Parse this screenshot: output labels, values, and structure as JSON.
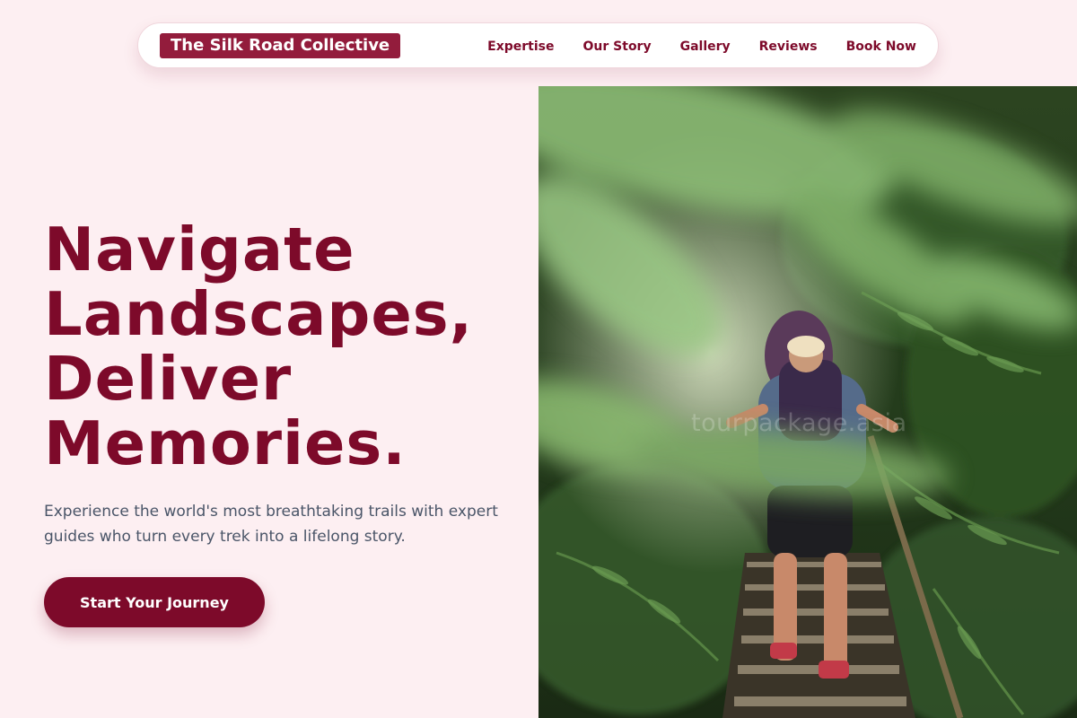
{
  "brand": {
    "name": "The Silk Road Collective"
  },
  "nav": {
    "items": [
      {
        "label": "Expertise"
      },
      {
        "label": "Our Story"
      },
      {
        "label": "Gallery"
      },
      {
        "label": "Reviews"
      },
      {
        "label": "Book Now"
      }
    ]
  },
  "hero": {
    "title_lines": [
      "Navigate",
      "Landscapes,",
      "Deliver",
      "Memories."
    ],
    "subtitle": "Experience the world's most breathtaking trails with expert guides who turn every trek into a lifelong story.",
    "cta_label": "Start Your Journey",
    "image": {
      "subject": "hikers climbing forest stairs among ferns",
      "watermark": "tourpackage.asia"
    }
  },
  "colors": {
    "background": "#fdeff2",
    "brand": "#7d0a2a",
    "logo_bg": "#931c3c",
    "text_muted": "#4a5568"
  }
}
